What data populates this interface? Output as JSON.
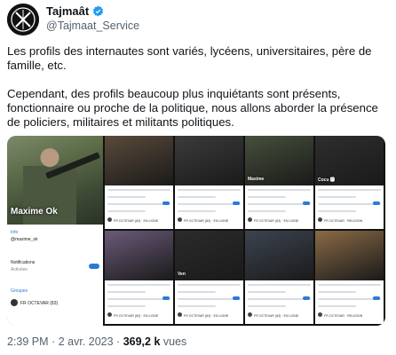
{
  "tweet": {
    "display_name": "Tajmaât",
    "handle": "@Tajmaat_Service",
    "paragraphs": [
      "Les profils des internautes sont variés, lycéens, universitaires, père de famille, etc.",
      "Cependant, des profils beaucoup plus inquiétants sont présents, fonctionnaire ou proche de la politique, nous allons aborder la présence de policiers, militaires et militants politiques."
    ],
    "time": "2:39 PM",
    "separator": "·",
    "date": "2 avr. 2023",
    "views_count": "369,2 k",
    "views_label": "vues"
  },
  "media": {
    "main_profile": {
      "name": "Maxime Ok",
      "sub": "",
      "info_labels": [
        "Info",
        "Notifications",
        "Groupes"
      ],
      "info_values": [
        "@maxime_ok",
        "Activées",
        "FR OCTEVAR (83)"
      ]
    },
    "cards": [
      {
        "name": "",
        "foot": "FR OCTEVAR (83) · EN LIGNE"
      },
      {
        "name": "",
        "foot": "FR OCTEVAR (83) · EN LIGNE"
      },
      {
        "name": "Maxime",
        "foot": "FR OCTEVAR (83) · EN LIGNE"
      },
      {
        "name": "Cocu 🅿",
        "foot": "FR OCTEVAR · RELIGION"
      },
      {
        "name": "",
        "foot": "FR OCTEVAR (83) · EN LIGNE"
      },
      {
        "name": "Ven",
        "foot": "FR OCTEVAR (83) · EN LIGNE"
      },
      {
        "name": "",
        "foot": "FR OCTEVAR (83) · EN LIGNE"
      },
      {
        "name": "",
        "foot": "FR OCTEVAR · RELIGION"
      }
    ],
    "colors": [
      "#5a4a3a",
      "#3b3b3b",
      "#46503c",
      "#2e2e2e",
      "#6b5a7a",
      "#2b2b2b",
      "#3c4450",
      "#8a6a46"
    ]
  }
}
